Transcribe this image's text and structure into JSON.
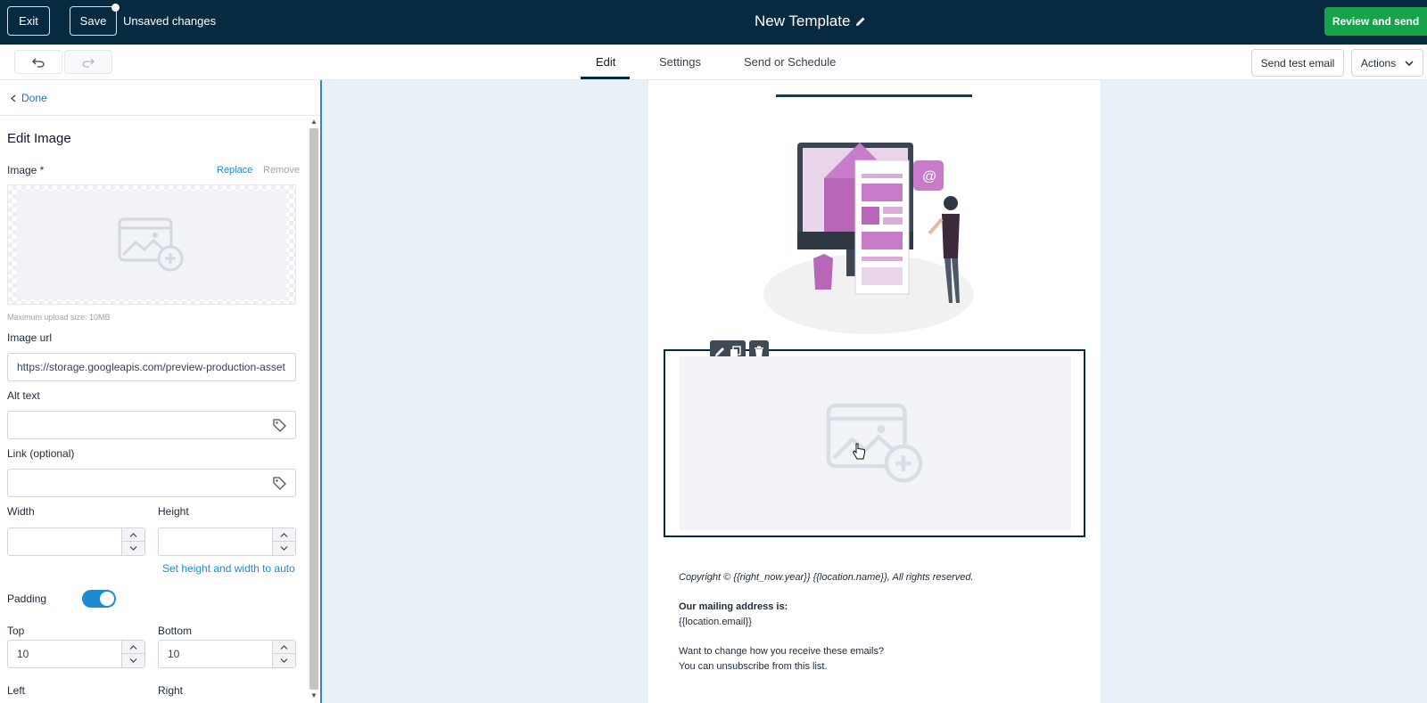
{
  "topbar": {
    "exit_label": "Exit",
    "save_label": "Save",
    "unsaved_label": "Unsaved changes",
    "title": "New Template",
    "review_label": "Review and send"
  },
  "subbar": {
    "tabs": [
      {
        "label": "Edit",
        "active": true
      },
      {
        "label": "Settings",
        "active": false
      },
      {
        "label": "Send or Schedule",
        "active": false
      }
    ],
    "send_test_label": "Send test email",
    "actions_label": "Actions"
  },
  "panel": {
    "done_label": "Done",
    "title": "Edit Image",
    "image_label": "Image *",
    "replace_label": "Replace",
    "remove_label": "Remove",
    "max_upload": "Maximum upload size: 10MB",
    "image_url_label": "Image url",
    "image_url_value": "https://storage.googleapis.com/preview-production-asset",
    "alt_text_label": "Alt text",
    "alt_text_value": "",
    "link_label": "Link (optional)",
    "link_value": "",
    "width_label": "Width",
    "width_value": "",
    "height_label": "Height",
    "height_value": "",
    "auto_link": "Set height and width to auto",
    "padding_label": "Padding",
    "padding_on": true,
    "top_label": "Top",
    "top_value": "10",
    "bottom_label": "Bottom",
    "bottom_value": "10",
    "left_label": "Left",
    "right_label": "Right"
  },
  "email": {
    "copyright": "Copyright © {{right_now.year}}  {{location.name}}, All rights reserved.",
    "mailing_heading": "Our mailing address is:",
    "mailing_value": "{{location.email}}",
    "change_line": "Want to change how you receive these emails?",
    "unsub_line": "You can unsubscribe from this list."
  },
  "colors": {
    "topbar": "#062a3f",
    "review": "#16a34a",
    "accent": "#1d8bd0"
  }
}
